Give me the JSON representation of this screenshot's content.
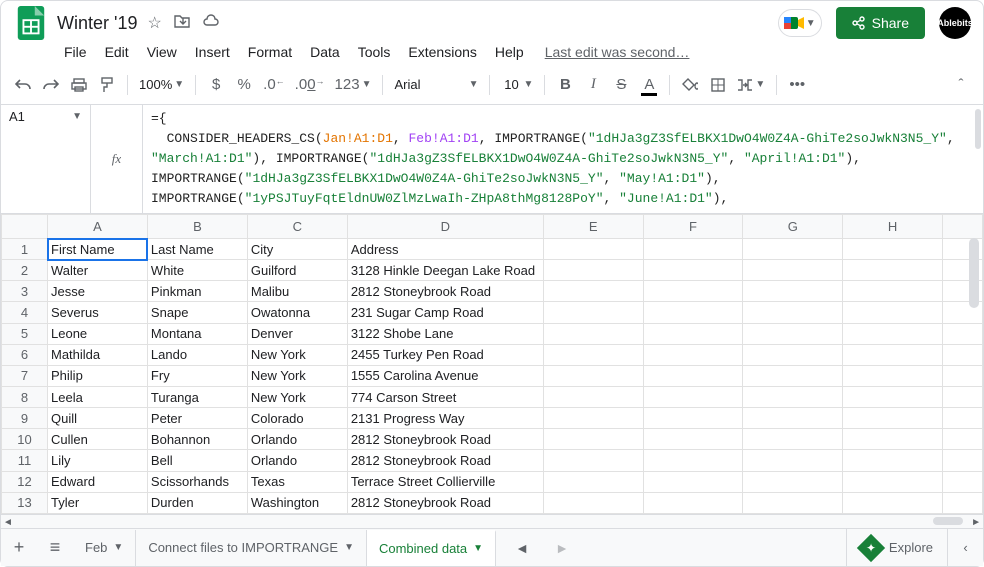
{
  "header": {
    "title": "Winter '19",
    "share_label": "Share",
    "avatar_label": "Ablebits",
    "last_edit": "Last edit was second…"
  },
  "menu": [
    "File",
    "Edit",
    "View",
    "Insert",
    "Format",
    "Data",
    "Tools",
    "Extensions",
    "Help"
  ],
  "toolbar": {
    "zoom": "100%",
    "currency": "$",
    "percent": "%",
    "dec_dec": ".0",
    "dec_inc": ".00",
    "num_fmt": "123",
    "font": "Arial",
    "size": "10",
    "bold": "B",
    "italic": "I",
    "strike": "S",
    "textcolor": "A"
  },
  "namebox": "A1",
  "fx": "fx",
  "formula": {
    "open": "={",
    "fn": "CONSIDER_HEADERS_CS",
    "ref1": "Jan!A1:D1",
    "ref2": "Feb!A1:D1",
    "imp": "IMPORTRANGE",
    "key1": "\"1dHJa3gZ3SfELBKX1DwO4W0Z4A-GhiTe2soJwkN3N5_Y\"",
    "march": "\"March!A1:D1\"",
    "april": "\"April!A1:D1\"",
    "may": "\"May!A1:D1\"",
    "key2": "\"1yPSJTuyFqtEldnUW0ZlMzLwaIh-ZHpA8thMg8128PoY\"",
    "june": "\"June!A1:D1\""
  },
  "columns": [
    "A",
    "B",
    "C",
    "D",
    "E",
    "F",
    "G",
    "H"
  ],
  "rows": [
    {
      "n": "1",
      "a": "First Name",
      "b": "Last Name",
      "c": "City",
      "d": "Address"
    },
    {
      "n": "2",
      "a": "Walter",
      "b": "White",
      "c": "Guilford",
      "d": "3128 Hinkle Deegan Lake Road"
    },
    {
      "n": "3",
      "a": "Jesse",
      "b": "Pinkman",
      "c": "Malibu",
      "d": "2812 Stoneybrook Road"
    },
    {
      "n": "4",
      "a": "Severus",
      "b": "Snape",
      "c": "Owatonna",
      "d": "231 Sugar Camp Road"
    },
    {
      "n": "5",
      "a": "Leone",
      "b": "Montana",
      "c": "Denver",
      "d": "3122 Shobe Lane"
    },
    {
      "n": "6",
      "a": "Mathilda",
      "b": "Lando",
      "c": "New York",
      "d": "2455 Turkey Pen Road"
    },
    {
      "n": "7",
      "a": "Philip",
      "b": "Fry",
      "c": "New York",
      "d": "1555 Carolina Avenue"
    },
    {
      "n": "8",
      "a": "Leela",
      "b": "Turanga",
      "c": "New York",
      "d": "774 Carson Street"
    },
    {
      "n": "9",
      "a": "Quill",
      "b": "Peter",
      "c": "Colorado",
      "d": "2131 Progress Way"
    },
    {
      "n": "10",
      "a": "Cullen",
      "b": "Bohannon",
      "c": "Orlando",
      "d": "2812 Stoneybrook Road"
    },
    {
      "n": "11",
      "a": "Lily",
      "b": "Bell",
      "c": "Orlando",
      "d": "2812 Stoneybrook Road"
    },
    {
      "n": "12",
      "a": "Edward",
      "b": "Scissorhands",
      "c": "Texas",
      "d": "Terrace Street Collierville"
    },
    {
      "n": "13",
      "a": "Tyler",
      "b": "Durden",
      "c": "Washington",
      "d": "2812 Stoneybrook Road"
    }
  ],
  "tabs": {
    "prev": "Feb",
    "mid": "Connect files to IMPORTRANGE",
    "active": "Combined data",
    "explore": "Explore"
  }
}
